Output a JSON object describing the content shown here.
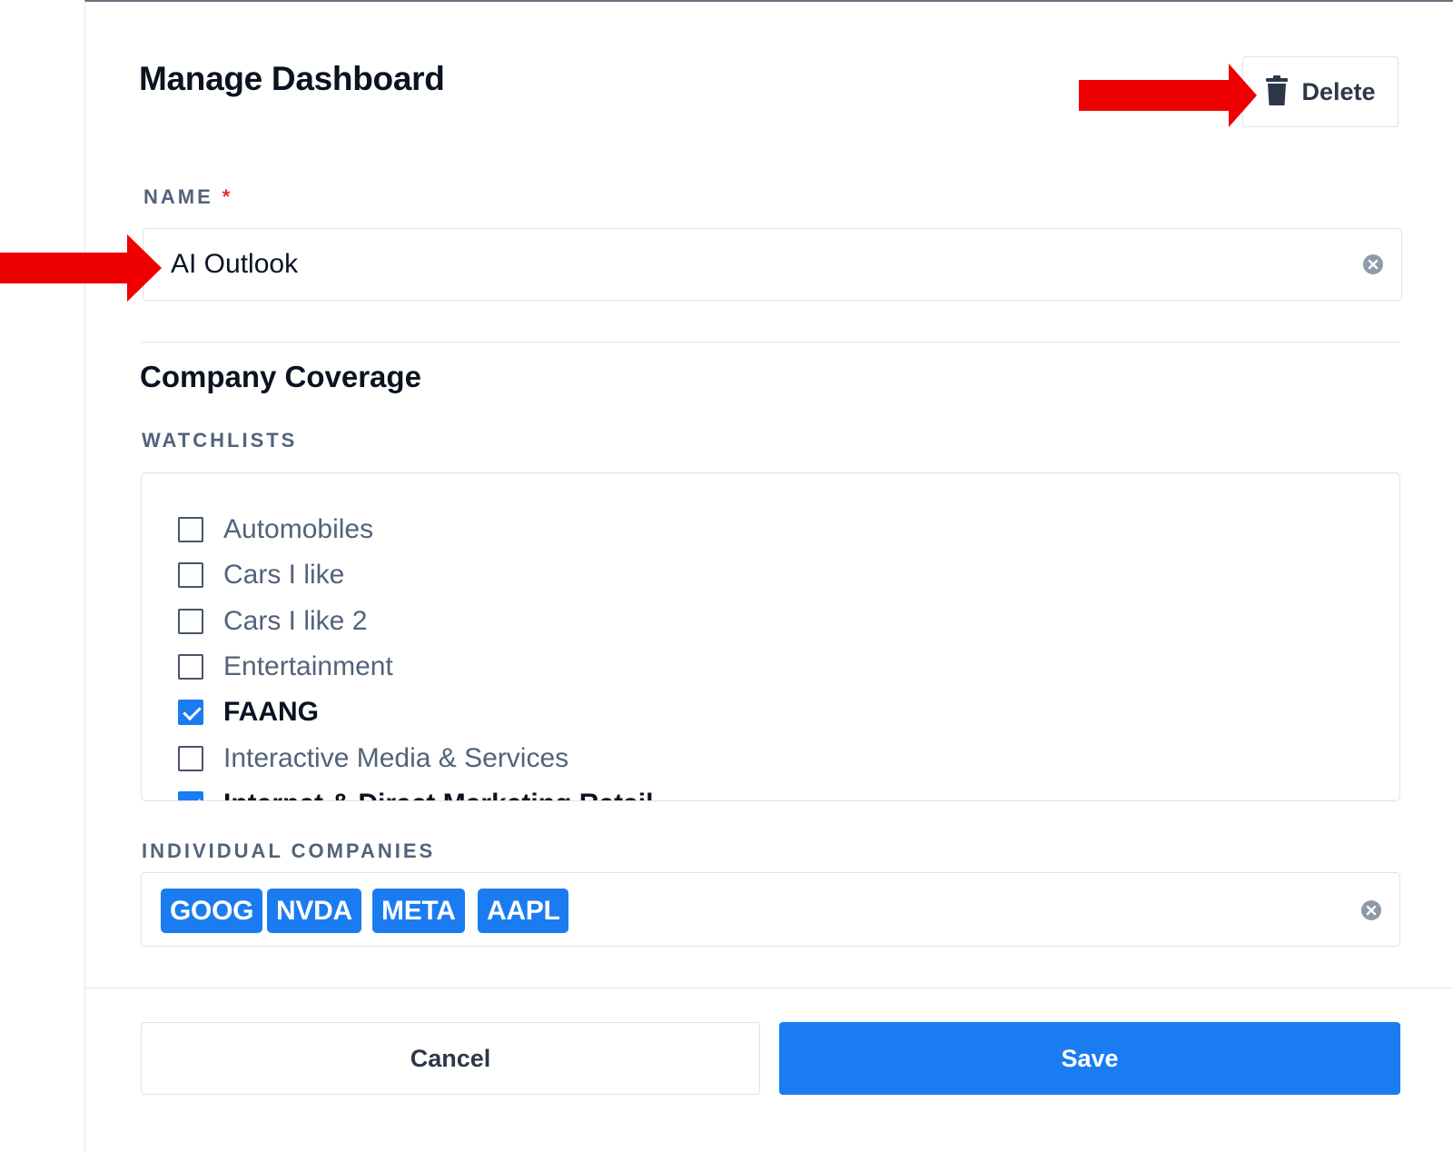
{
  "modal": {
    "title": "Manage Dashboard",
    "delete_label": "Delete"
  },
  "name_field": {
    "label": "NAME",
    "required_mark": "*",
    "value": "AI Outlook"
  },
  "coverage": {
    "heading": "Company Coverage",
    "watchlists_label": "WATCHLISTS",
    "watchlists": [
      {
        "label": "Automobiles",
        "checked": false
      },
      {
        "label": "Cars I like",
        "checked": false
      },
      {
        "label": "Cars I like 2",
        "checked": false
      },
      {
        "label": "Entertainment",
        "checked": false
      },
      {
        "label": "FAANG",
        "checked": true
      },
      {
        "label": "Interactive Media & Services",
        "checked": false
      },
      {
        "label": "Internet & Direct Marketing Retail",
        "checked": true
      }
    ],
    "companies_label": "INDIVIDUAL COMPANIES",
    "companies": [
      "GOOG",
      "NVDA",
      "META",
      "AAPL"
    ]
  },
  "footer": {
    "cancel_label": "Cancel",
    "save_label": "Save"
  },
  "colors": {
    "accent": "#1a7cf0",
    "annotation_arrow": "#ee0000"
  },
  "icons": [
    "trash-icon",
    "clear-icon",
    "checkbox-icon",
    "arrow-annotation"
  ]
}
